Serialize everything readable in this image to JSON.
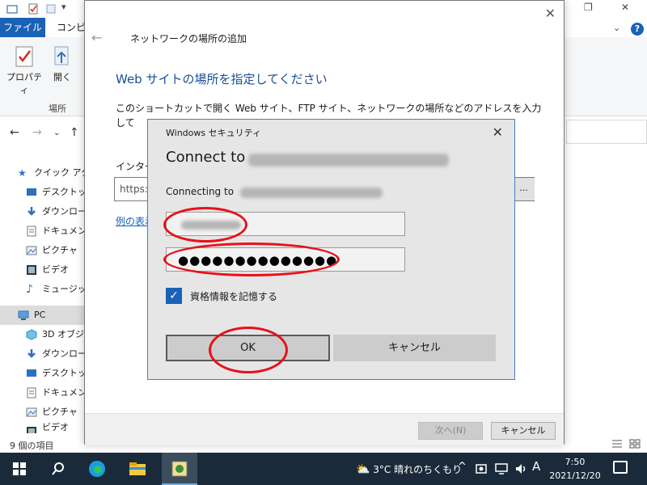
{
  "explorer": {
    "tab_file": "ファイル",
    "tab_computer": "コンピュ",
    "ribbon_properties": "プロパティ",
    "ribbon_open": "開く",
    "ribbon_group": "場所",
    "status": "9 個の項目",
    "sidebar": [
      {
        "label": "クイック アク",
        "top": true
      },
      {
        "label": "デスクトップ"
      },
      {
        "label": "ダウンロード"
      },
      {
        "label": "ドキュメント"
      },
      {
        "label": "ピクチャ"
      },
      {
        "label": "ビデオ"
      },
      {
        "label": "ミュージック"
      },
      {
        "label": "PC",
        "top": true
      },
      {
        "label": "3D オブジェ"
      },
      {
        "label": "ダウンロード"
      },
      {
        "label": "デスクトップ"
      },
      {
        "label": "ドキュメント"
      },
      {
        "label": "ピクチャ"
      },
      {
        "label": "ビデオ"
      }
    ]
  },
  "wizard": {
    "title": "ネットワークの場所の追加",
    "heading": "Web サイトの場所を指定してください",
    "description": "このショートカットで開く Web サイト、FTP サイト、ネットワークの場所などのアドレスを入力して",
    "address_label": "インター",
    "address_value": "https:",
    "browse": "...",
    "examples_link": "例の表示",
    "next_button": "次へ(N)",
    "cancel_button": "キャンセル"
  },
  "security": {
    "window_title": "Windows セキュリティ",
    "heading_prefix": "Connect to",
    "connecting_prefix": "Connecting to",
    "password_mask": "●●●●●●●●●●●●●●",
    "remember_label": "資格情報を記憶する",
    "ok_button": "OK",
    "cancel_button": "キャンセル"
  },
  "taskbar": {
    "weather": "3°C  晴れのちくもり",
    "ime": "A",
    "time": "7:50",
    "date": "2021/12/20"
  },
  "colors": {
    "accent": "#1a62b6",
    "highlight": "#e8101a"
  }
}
